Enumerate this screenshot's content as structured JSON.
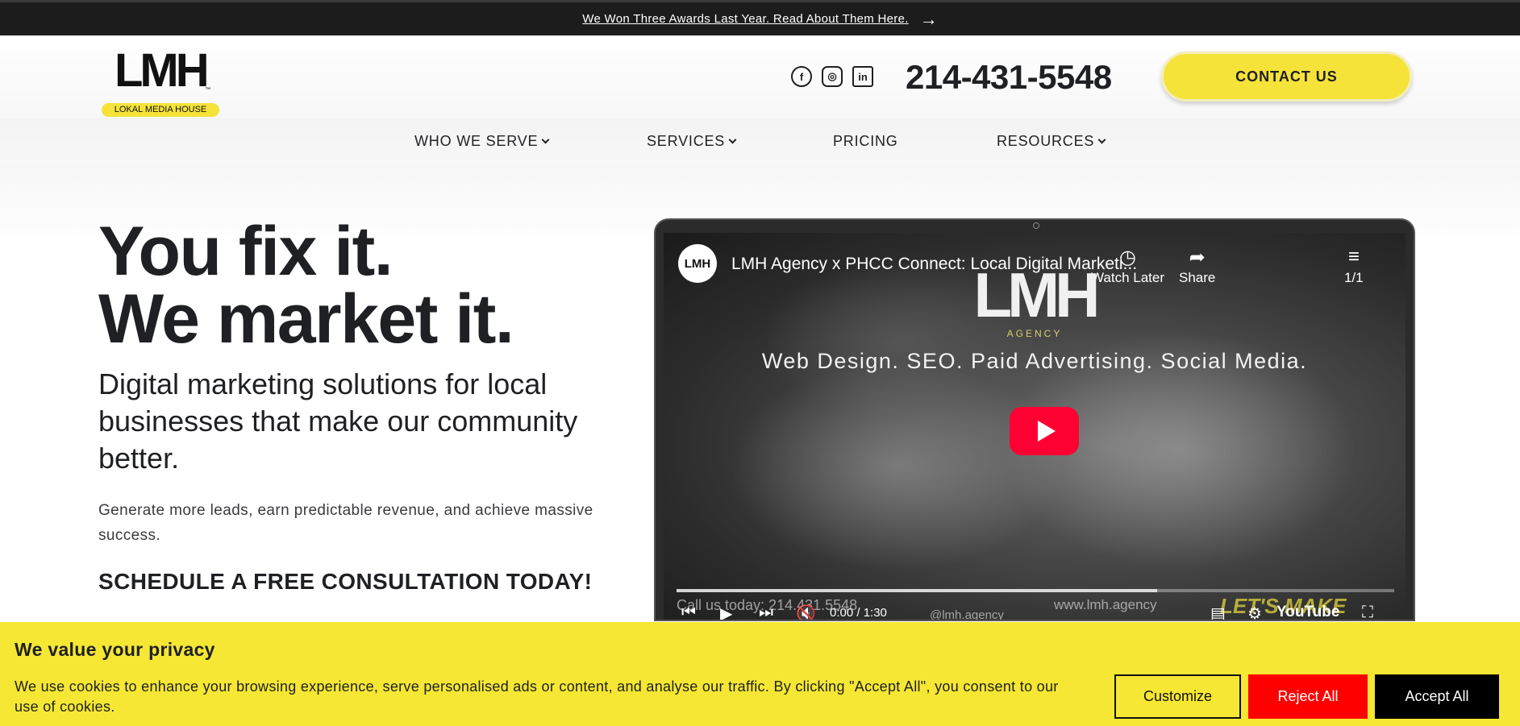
{
  "announcement": {
    "text": "We Won Three Awards Last Year. Read About Them Here.",
    "arrow": "→"
  },
  "logo": {
    "mark": "LMH",
    "tm": "™",
    "tagline": "LOKAL MEDIA HOUSE"
  },
  "social": {
    "facebook": "f",
    "instagram": "◎",
    "linkedin": "in"
  },
  "phone": "214-431-5548",
  "contact_button": "CONTACT US",
  "nav": {
    "who": "WHO WE SERVE",
    "services": "SERVICES",
    "pricing": "PRICING",
    "resources": "RESOURCES"
  },
  "hero": {
    "line1": "You fix it.",
    "line2": "We market it.",
    "subtitle": "Digital marketing solutions for local businesses that make our community better.",
    "body": "Generate more leads, earn predictable revenue, and achieve massive success.",
    "cta": "SCHEDULE A FREE CONSULTATION TODAY!"
  },
  "video": {
    "channel_avatar": "LMH",
    "title": "LMH Agency x PHCC Connect: Local Digital Marketi...",
    "watch_later": "Watch Later",
    "share": "Share",
    "playlist": "1/1",
    "brand": "LMH",
    "agency": "AGENCY",
    "tagline": "Web Design. SEO. Paid Advertising. Social Media.",
    "call": "Call us today: 214.431.5548",
    "handle": "@lmh.agency",
    "site": "www.lmh.agency",
    "waves": "LET'S MAKE WAVES",
    "time": "0:00 / 1:30",
    "youtube": "YouTube",
    "progress": 0.67
  },
  "cookie": {
    "title": "We value your privacy",
    "text": "We use cookies to enhance your browsing experience, serve personalised ads or content, and analyse our traffic. By clicking \"Accept All\", you consent to our use of cookies.",
    "customize": "Customize",
    "reject": "Reject All",
    "accept": "Accept All"
  },
  "colors": {
    "accent": "#f5e33a",
    "dark": "#1f2023",
    "reject": "#ff0000",
    "youtube_red": "#ff0033"
  }
}
